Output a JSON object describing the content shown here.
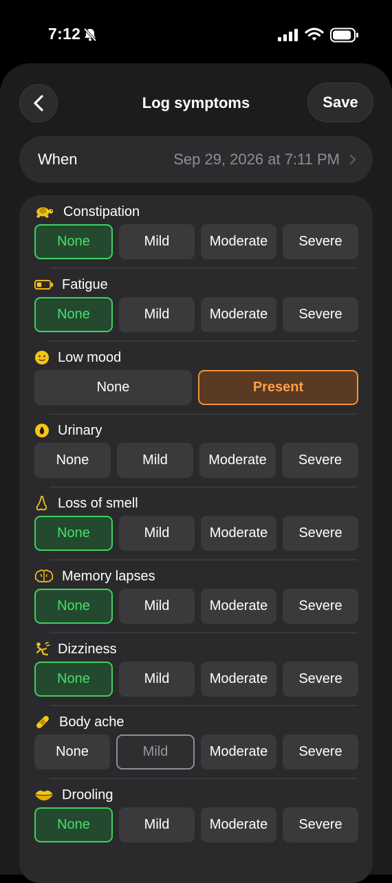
{
  "status_bar": {
    "time": "7:12"
  },
  "header": {
    "title": "Log symptoms",
    "save_label": "Save"
  },
  "when": {
    "label": "When",
    "value": "Sep 29, 2026 at 7:11 PM"
  },
  "colors": {
    "selected_green": "#3fd162",
    "selected_orange": "#f0953a",
    "selected_gray": "#8e8e93"
  },
  "symptoms": [
    {
      "label": "Constipation",
      "icon": "turtle-icon",
      "options": [
        "None",
        "Mild",
        "Moderate",
        "Severe"
      ],
      "selected": "None"
    },
    {
      "label": "Fatigue",
      "icon": "low-battery-icon",
      "options": [
        "None",
        "Mild",
        "Moderate",
        "Severe"
      ],
      "selected": "None"
    },
    {
      "label": "Low mood",
      "icon": "slight-smile-icon",
      "options": [
        "None",
        "Present"
      ],
      "selected": "Present"
    },
    {
      "label": "Urinary",
      "icon": "droplet-icon",
      "options": [
        "None",
        "Mild",
        "Moderate",
        "Severe"
      ],
      "selected": ""
    },
    {
      "label": "Loss of smell",
      "icon": "nose-icon",
      "options": [
        "None",
        "Mild",
        "Moderate",
        "Severe"
      ],
      "selected": "None"
    },
    {
      "label": "Memory lapses",
      "icon": "brain-icon",
      "options": [
        "None",
        "Mild",
        "Moderate",
        "Severe"
      ],
      "selected": "None"
    },
    {
      "label": "Dizziness",
      "icon": "falling-person-icon",
      "options": [
        "None",
        "Mild",
        "Moderate",
        "Severe"
      ],
      "selected": "None"
    },
    {
      "label": "Body ache",
      "icon": "bandage-icon",
      "options": [
        "None",
        "Mild",
        "Moderate",
        "Severe"
      ],
      "selected": "Mild"
    },
    {
      "label": "Drooling",
      "icon": "lips-icon",
      "options": [
        "None",
        "Mild",
        "Moderate",
        "Severe"
      ],
      "selected": "None"
    }
  ]
}
